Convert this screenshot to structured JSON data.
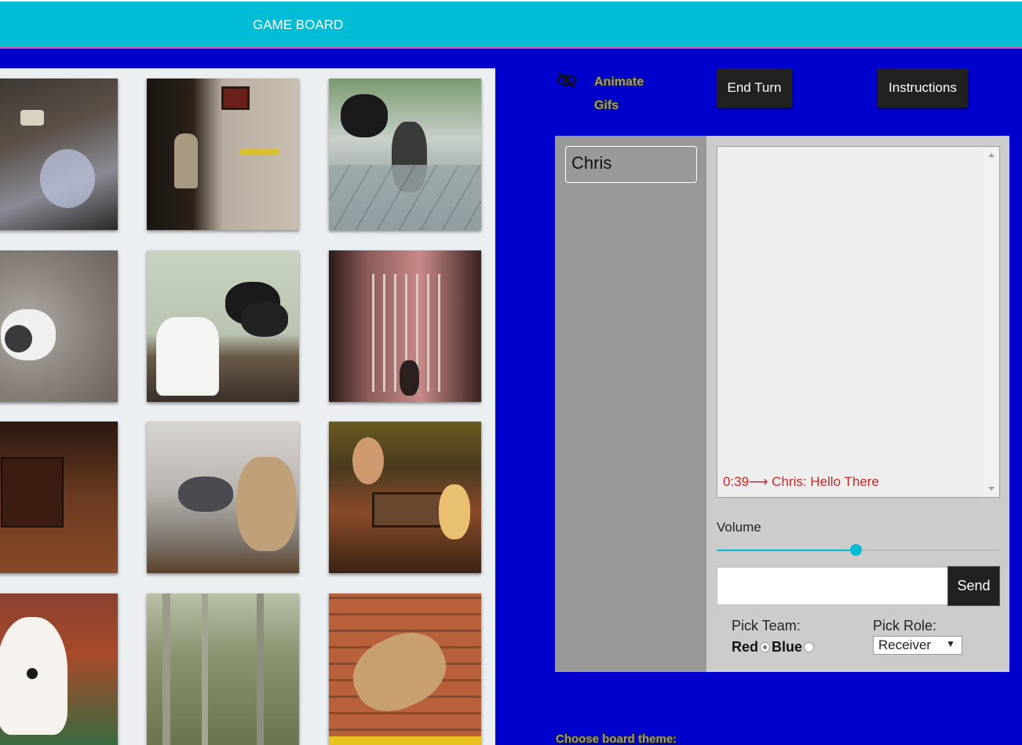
{
  "header": {
    "title": "GAME BOARD"
  },
  "colors": {
    "header_bg": "#00bcd4",
    "page_bg": "#0000cc",
    "accent": "#00bcd4",
    "chat_message": "#c62828"
  },
  "board": {
    "tiles": [
      {
        "icon": "gif-cat-balloon"
      },
      {
        "icon": "gif-cat-wall"
      },
      {
        "icon": "gif-cats-door"
      },
      {
        "icon": "gif-rabbit"
      },
      {
        "icon": "gif-cats-table"
      },
      {
        "icon": "gif-cat-gate"
      },
      {
        "icon": "gif-cat-box"
      },
      {
        "icon": "gif-dog-cat-window"
      },
      {
        "icon": "gif-cat-table-game"
      },
      {
        "icon": "gif-white-kitten"
      },
      {
        "icon": "gif-forest"
      },
      {
        "icon": "gif-cat-bricks"
      }
    ]
  },
  "controls": {
    "animate_gifs_label": "Animate Gifs",
    "animate_icon": "eye-off-icon",
    "end_turn_label": "End Turn",
    "instructions_label": "Instructions"
  },
  "players": [
    {
      "name": "Chris"
    }
  ],
  "chat": {
    "messages": [
      {
        "text": "0:39⟶ Chris: Hello There"
      }
    ],
    "input_value": "",
    "send_label": "Send"
  },
  "volume": {
    "label": "Volume",
    "level": 0.49
  },
  "team": {
    "label": "Pick Team:",
    "options": [
      "Red",
      "Blue"
    ],
    "selected": "Red"
  },
  "role": {
    "label": "Pick Role:",
    "selected": "Receiver"
  },
  "theme": {
    "label": "Choose board theme:"
  }
}
